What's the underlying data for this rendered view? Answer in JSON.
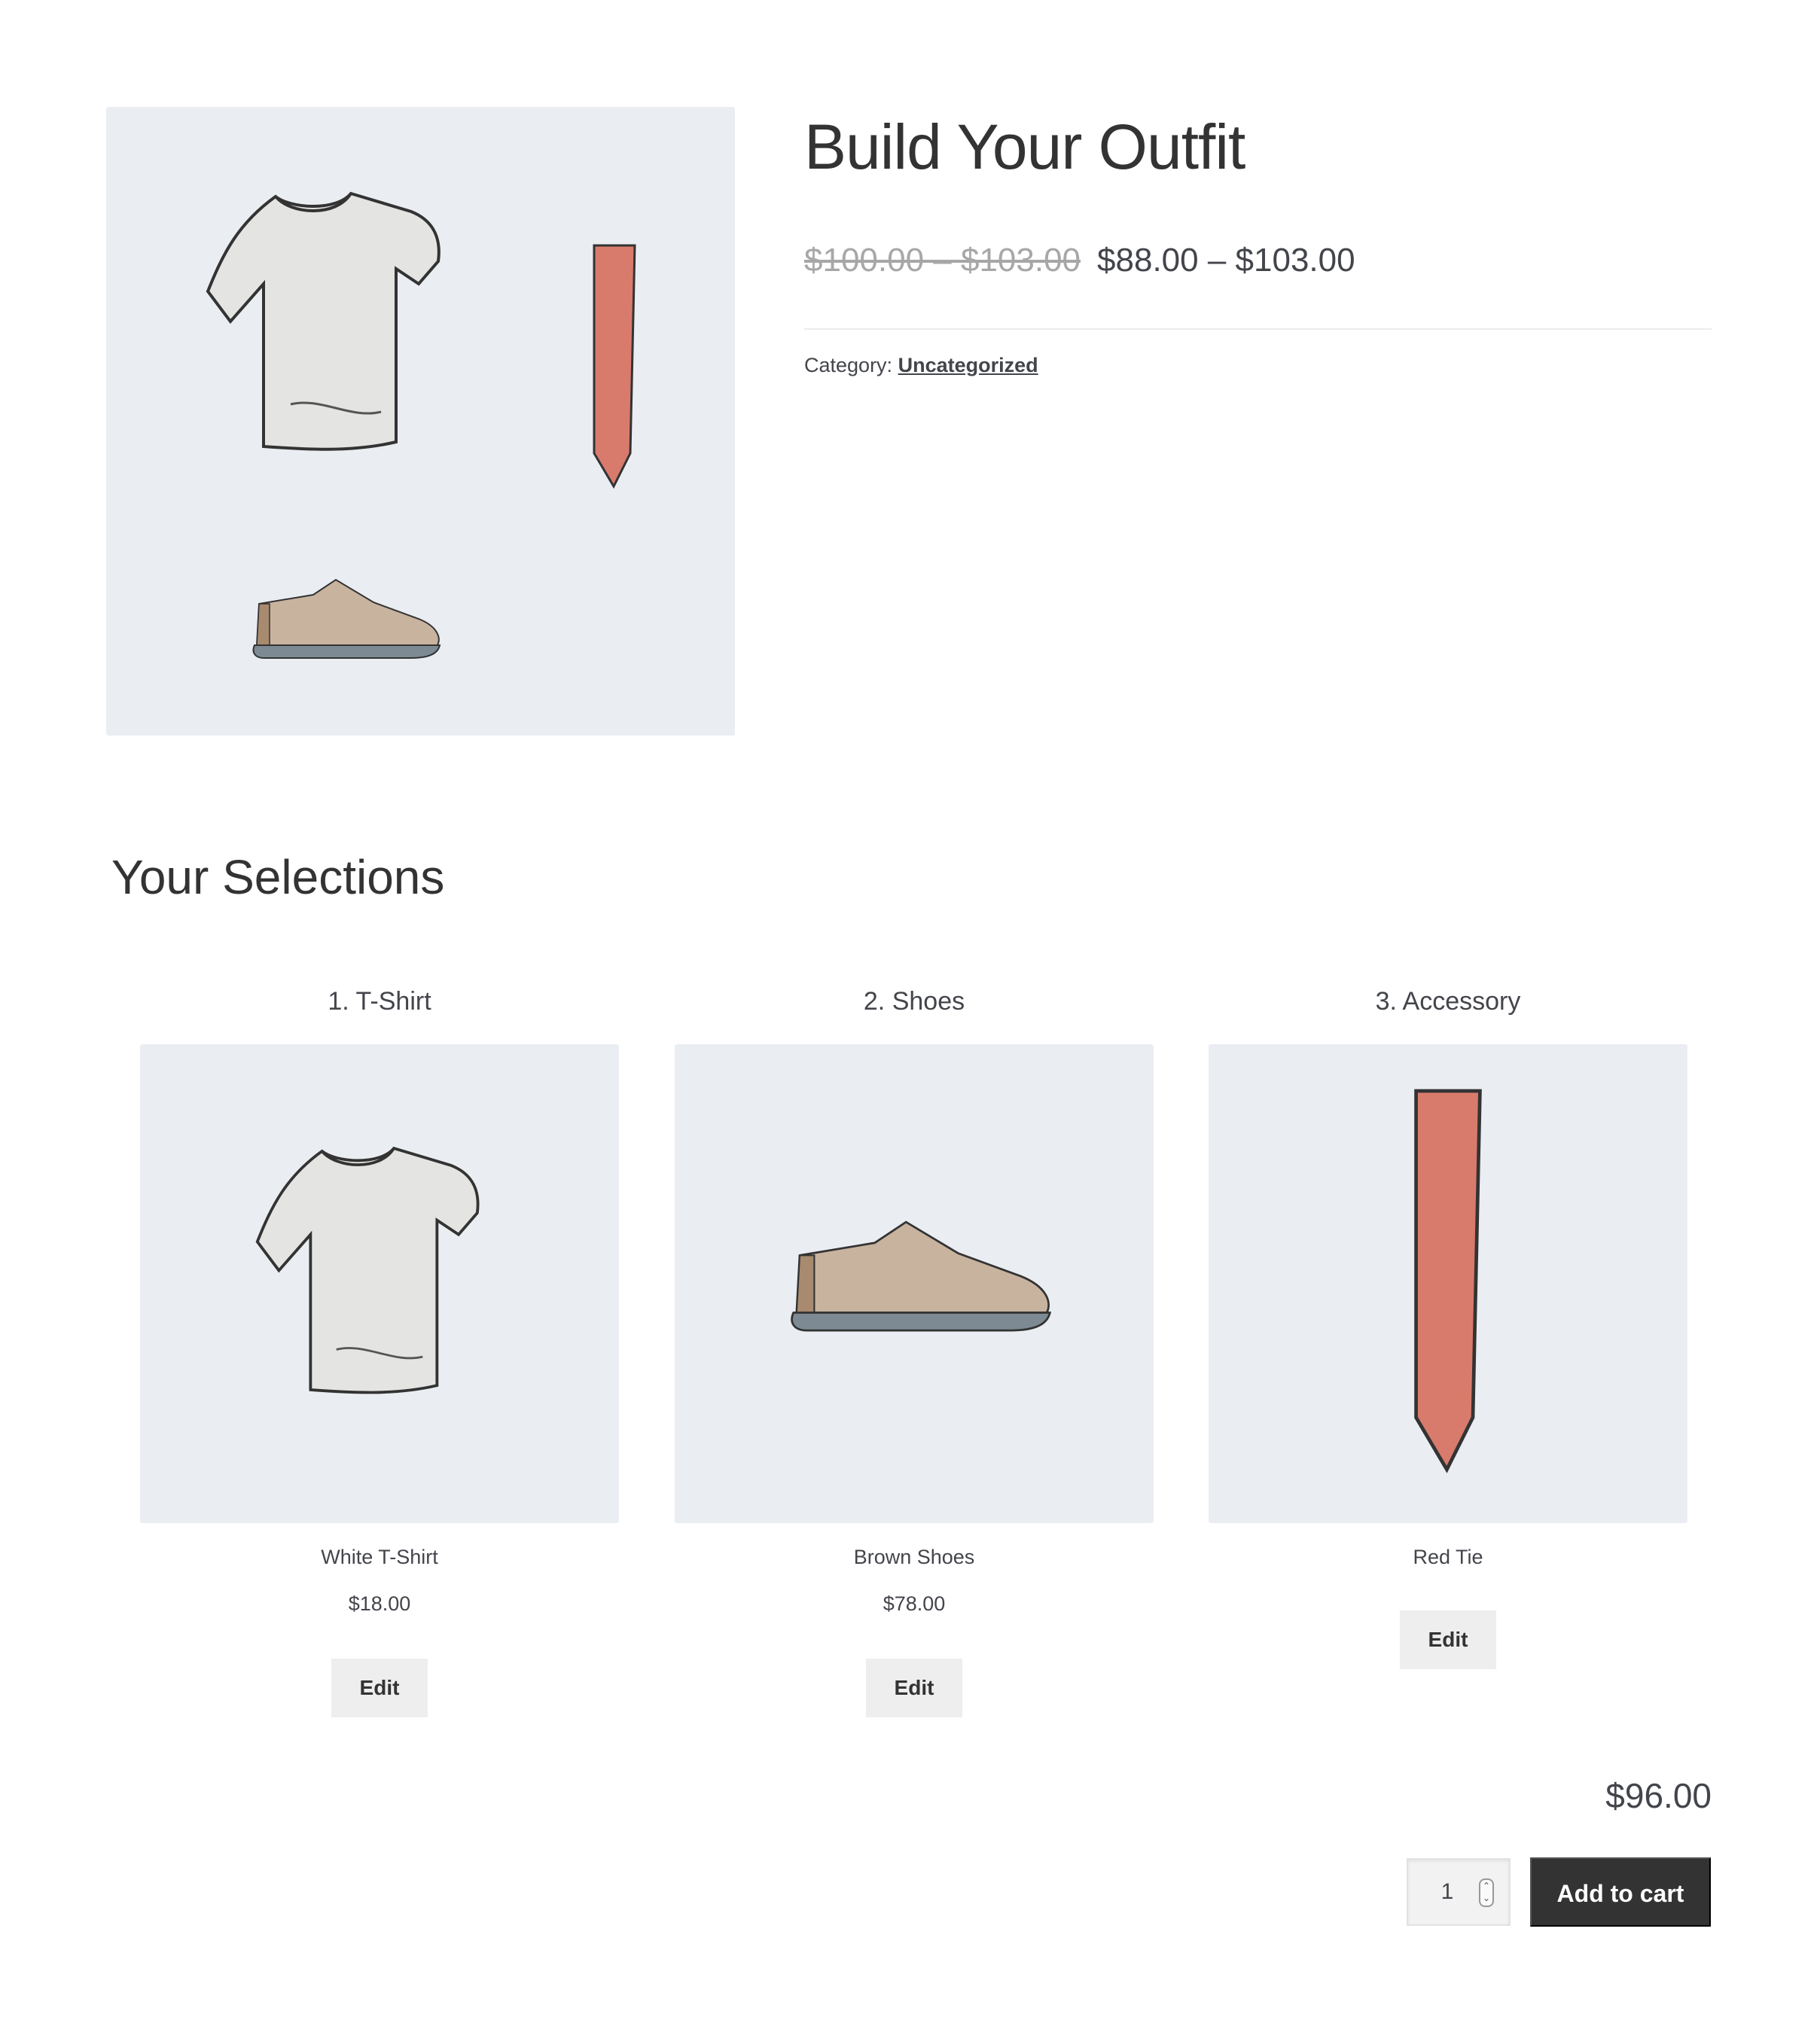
{
  "product": {
    "title": "Build Your Outfit",
    "price_regular": "$100.00 – $103.00",
    "price_sale": "$88.00 – $103.00",
    "category_label": "Category:",
    "category_link": "Uncategorized",
    "image_icons": [
      "t-shirt-icon",
      "tie-icon",
      "shoe-icon"
    ]
  },
  "selections": {
    "title": "Your Selections",
    "steps": [
      {
        "label": "1. T-Shirt",
        "name": "White T-Shirt",
        "price": "$18.00",
        "edit_label": "Edit",
        "icon": "t-shirt-icon"
      },
      {
        "label": "2. Shoes",
        "name": "Brown Shoes",
        "price": "$78.00",
        "edit_label": "Edit",
        "icon": "shoe-icon"
      },
      {
        "label": "3. Accessory",
        "name": "Red Tie",
        "edit_label": "Edit",
        "icon": "tie-icon"
      }
    ]
  },
  "cart": {
    "total": "$96.00",
    "quantity": "1",
    "add_label": "Add to cart"
  },
  "colors": {
    "image_bg": "#eaedf2",
    "button_dark": "#333333",
    "button_light": "#eeeeee",
    "tie": "#d97b6c",
    "shoe": "#c8b39f",
    "sole": "#7d8a94"
  }
}
